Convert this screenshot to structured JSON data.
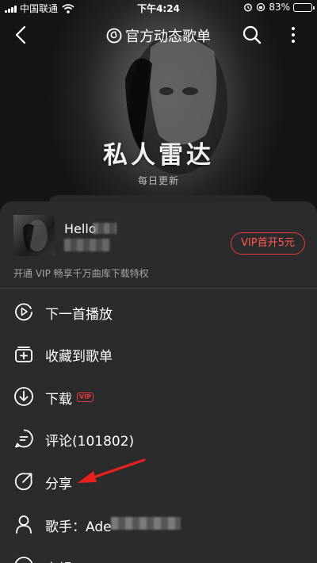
{
  "status_bar": {
    "carrier": "中国联通",
    "time": "下午4:24",
    "battery_percent": "83%",
    "battery_level": 0.83,
    "icons": [
      "signal-icon",
      "wifi-icon",
      "alarm-icon",
      "rotation-lock-icon",
      "battery-icon"
    ]
  },
  "nav": {
    "title": "官方动态歌单",
    "icons": [
      "back-icon",
      "netease-logo-icon",
      "search-icon",
      "more-vertical-icon"
    ]
  },
  "hero": {
    "title": "私人雷达",
    "subtitle": "每日更新"
  },
  "song": {
    "name": "Hello",
    "vip_button": "VIP首开5元",
    "vip_note": "开通 VIP 畅享千万曲库下载特权"
  },
  "menu": {
    "items": [
      {
        "label": "下一首播放",
        "icon": "play-next-icon"
      },
      {
        "label": "收藏到歌单",
        "icon": "add-to-playlist-icon"
      },
      {
        "label": "下载",
        "icon": "download-icon",
        "tag": "VIP"
      },
      {
        "label": "评论(101802)",
        "icon": "comment-icon"
      },
      {
        "label": "分享",
        "icon": "share-icon"
      },
      {
        "label": "歌手：Ade",
        "icon": "artist-icon"
      },
      {
        "label": "专辑",
        "icon": "album-icon"
      }
    ]
  },
  "colors": {
    "accent": "#e53935",
    "sheet_bg": "#2b2b2d",
    "text_secondary": "#a6a6a6"
  }
}
